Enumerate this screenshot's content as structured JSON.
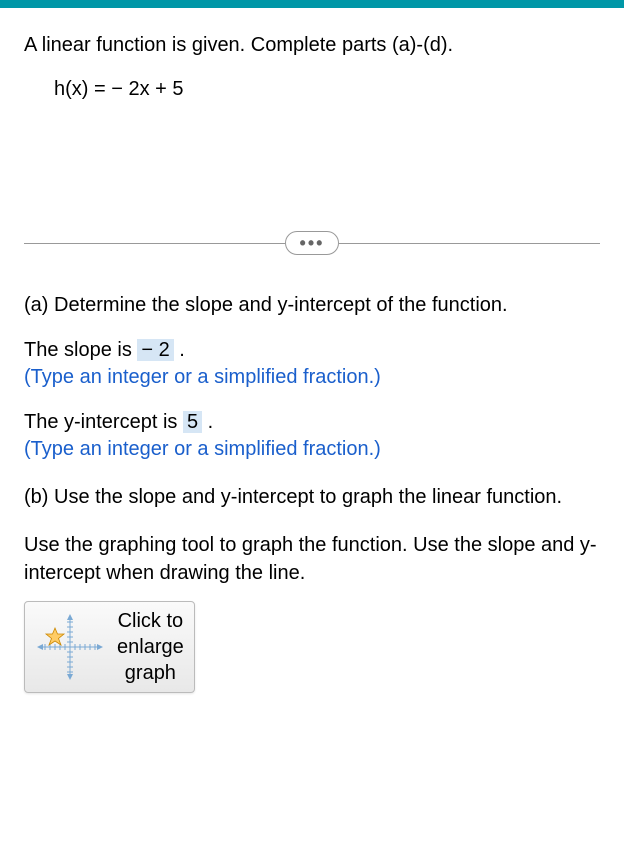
{
  "problem": {
    "statement": "A linear function is given. Complete parts (a)-(d).",
    "equation": "h(x) = − 2x + 5"
  },
  "divider": {
    "dots": "•••"
  },
  "partA": {
    "heading": "(a) Determine the slope and y-intercept of the function.",
    "slope": {
      "prefix": "The slope is ",
      "value": "− 2",
      "suffix": " ."
    },
    "intercept": {
      "prefix": "The y-intercept is ",
      "value": "5",
      "suffix": " ."
    },
    "hint": "(Type an integer or a simplified fraction.)"
  },
  "partB": {
    "heading": "(b) Use the slope and y-intercept to graph the linear function.",
    "instruction": "Use the graphing tool to graph the function. Use the slope and y-intercept when drawing the line.",
    "button": {
      "line1": "Click to",
      "line2": "enlarge",
      "line3": "graph"
    }
  }
}
